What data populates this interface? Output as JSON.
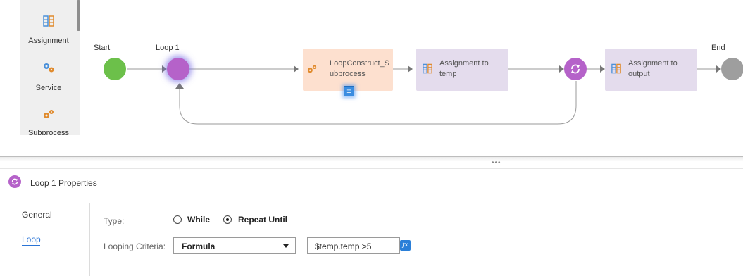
{
  "palette": {
    "items": [
      {
        "label": "Assignment",
        "icon": "assignment-icon"
      },
      {
        "label": "Service",
        "icon": "service-gears-icon"
      },
      {
        "label": "Subprocess",
        "icon": "subprocess-gears-icon"
      }
    ]
  },
  "canvas": {
    "start_label": "Start",
    "loop_label": "Loop 1",
    "end_label": "End",
    "subprocess_step": {
      "line1": "LoopConstruct_S",
      "line2": "ubprocess"
    },
    "assign_temp_step": {
      "line1": "Assignment to",
      "line2": "temp"
    },
    "assign_output_step": {
      "line1": "Assignment to",
      "line2": "output"
    },
    "colors": {
      "start": "#6cc04a",
      "loop": "#b562c9",
      "end": "#9e9e9e",
      "subprocess_bg": "#fde0cf",
      "assignment_bg": "#e4dced",
      "connector": "#9a9a9a"
    }
  },
  "splitter": {
    "grip": "•••"
  },
  "properties": {
    "title": "Loop 1 Properties",
    "nav": {
      "general": "General",
      "loop": "Loop"
    },
    "type_label": "Type:",
    "type_options": [
      "While",
      "Repeat Until"
    ],
    "type_selected": "Repeat Until",
    "criteria_label": "Looping Criteria:",
    "criteria_select": "Formula",
    "criteria_expression": "$temp.temp >5",
    "fx_label": "fx"
  }
}
